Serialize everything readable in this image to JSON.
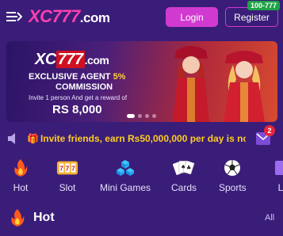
{
  "header": {
    "logo_xc": "XC",
    "logo_num": "777",
    "logo_domain": ".com",
    "login_label": "Login",
    "register_label": "Register",
    "register_badge": "100-777"
  },
  "banner": {
    "logo_xc": "XC",
    "logo_num": "777",
    "logo_domain": ".com",
    "title": "EXCLUSIVE AGENT ",
    "title_pct": "5%",
    "commission": "COMMISSION",
    "sub": "Invite 1 person And get a reward of",
    "amount": "RS 8,000"
  },
  "marquee": {
    "text": "Invite friends, earn Rs50,000,000  per day is not a"
  },
  "mail_badge": "2",
  "categories": [
    {
      "label": "Hot",
      "icon": "fire-icon"
    },
    {
      "label": "Slot",
      "icon": "slot-machine-icon"
    },
    {
      "label": "Mini Games",
      "icon": "cubes-icon"
    },
    {
      "label": "Cards",
      "icon": "playing-cards-icon"
    },
    {
      "label": "Sports",
      "icon": "soccer-ball-icon"
    },
    {
      "label": "L",
      "icon": "lottery-icon"
    }
  ],
  "section": {
    "title": "Hot",
    "all_label": "All"
  },
  "colors": {
    "background": "#3a1d78",
    "accent": "#d13ad0",
    "marquee": "#ffcc22",
    "badge_green": "#1fa346"
  }
}
